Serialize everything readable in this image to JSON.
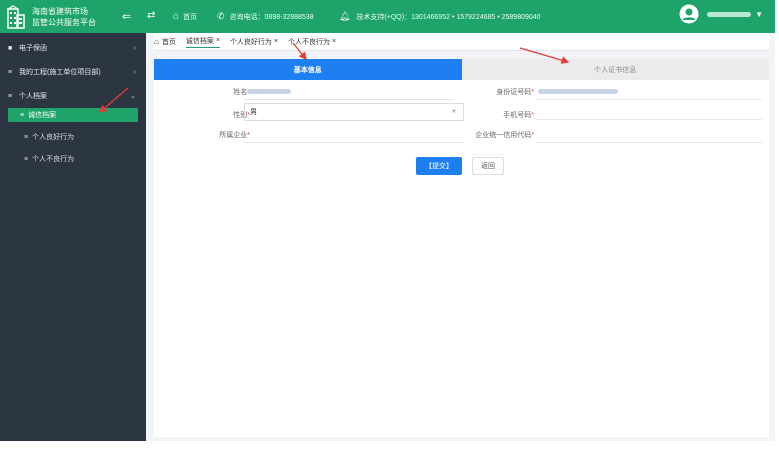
{
  "header": {
    "platform_title_line1": "海南省建筑市场",
    "platform_title_line2": "监管公共服务平台",
    "home_label": "首页",
    "consult_phone": "咨询电话：0898-32888538",
    "tech_support": "技术支持(+QQ)：1301466952 • 1579224685 • 2589809040"
  },
  "sidebar": {
    "items": [
      {
        "label": "电子保函"
      },
      {
        "label": "我的工程(施工单位项目部)"
      },
      {
        "label": "个人档案"
      }
    ],
    "subitems": [
      {
        "label": "诚信档案"
      },
      {
        "label": "个人良好行为"
      },
      {
        "label": "个人不良行为"
      }
    ]
  },
  "tabs": [
    {
      "label": "首页"
    },
    {
      "label": "诚信档案"
    },
    {
      "label": "个人良好行为"
    },
    {
      "label": "个人不良行为"
    }
  ],
  "panel": {
    "tab_basic": "基本信息",
    "tab_cert": "个人证书信息"
  },
  "form": {
    "name_label": "姓名",
    "idcard_label": "身份证号码",
    "gender_label": "性别",
    "gender_value": "男",
    "phone_label": "手机号码",
    "company_label": "所属企业",
    "credit_code_label": "企业统一信用代码",
    "required_mark": "*"
  },
  "buttons": {
    "submit": "【提交】",
    "back": "返回"
  },
  "colors": {
    "brand_green": "#1ea36b",
    "sidebar_bg": "#2c3643",
    "primary_blue": "#1e7ff0",
    "annotation_red": "#e53935"
  }
}
